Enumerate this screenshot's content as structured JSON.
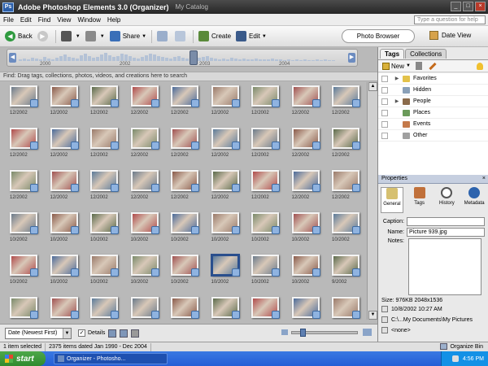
{
  "titlebar": {
    "logo": "Ps",
    "title": "Adobe Photoshop Elements 3.0 (Organizer)",
    "catalog": "My Catalog",
    "controls": [
      "_",
      "□",
      "×"
    ]
  },
  "menu": {
    "items": [
      "File",
      "Edit",
      "Find",
      "View",
      "Window",
      "Help"
    ],
    "help_placeholder": "Type a question for help"
  },
  "toolbar": {
    "back": "Back",
    "share": "Share",
    "create": "Create",
    "edit": "Edit",
    "photo_browser": "Photo Browser",
    "date_view": "Date View"
  },
  "timeline": {
    "years": [
      "2000",
      "2002",
      "2003",
      "2004"
    ]
  },
  "findbar": {
    "text": "Find: Drag tags, collections, photos, videos, and creations here to search"
  },
  "grid": {
    "rows": [
      [
        "12/2002",
        "12/2002",
        "12/2002",
        "12/2002",
        "12/2002",
        "12/2002",
        "12/2002",
        "12/2002",
        "12/2002"
      ],
      [
        "12/2002",
        "12/2002",
        "12/2002",
        "12/2002",
        "12/2002",
        "12/2002",
        "12/2002",
        "12/2002",
        "12/2002"
      ],
      [
        "12/2002",
        "12/2002",
        "12/2002",
        "12/2002",
        "12/2002",
        "12/2002",
        "12/2002",
        "12/2002",
        "12/2002"
      ],
      [
        "10/2002",
        "10/2002",
        "10/2002",
        "10/2002",
        "10/2002",
        "10/2002",
        "10/2002",
        "10/2002",
        "10/2002"
      ],
      [
        "10/2002",
        "10/2002",
        "10/2002",
        "10/2002",
        "10/2002",
        "10/2002",
        "10/2002",
        "10/2002",
        "9/2002"
      ],
      [
        "",
        "",
        "",
        "",
        "",
        "",
        "",
        "",
        ""
      ]
    ],
    "selected_row": 4,
    "selected_col": 5,
    "photo_colors": [
      "#6a7a8a",
      "#8a5a4a",
      "#5a6a4a",
      "#b04a4a",
      "#4a6a9a",
      "#9a7a6a",
      "#7a8a6a",
      "#a05050",
      "#5a7a9a"
    ]
  },
  "bottombar": {
    "sort": "Date (Newest First)",
    "details_label": "Details",
    "details_checked": "✓"
  },
  "panel": {
    "tabs": [
      "Tags",
      "Collections"
    ],
    "new_label": "New",
    "tags": [
      {
        "label": "Favorites",
        "arrow": "▶",
        "icon": "ti-fav"
      },
      {
        "label": "Hidden",
        "arrow": "",
        "icon": "ti-hidden"
      },
      {
        "label": "People",
        "arrow": "▶",
        "icon": "ti-people"
      },
      {
        "label": "Places",
        "arrow": "",
        "icon": "ti-places"
      },
      {
        "label": "Events",
        "arrow": "",
        "icon": "ti-events"
      },
      {
        "label": "Other",
        "arrow": "",
        "icon": "ti-other"
      }
    ]
  },
  "properties": {
    "header": "Properties",
    "tabs": [
      "General",
      "Tags",
      "History",
      "Metadata"
    ],
    "caption_label": "Caption:",
    "name_label": "Name:",
    "name_value": "Picture 939.jpg",
    "notes_label": "Notes:",
    "size": "Size: 976KB  2048x1536",
    "date": "10/8/2002 10:27 AM",
    "path": "C:\\...My Documents\\My Pictures",
    "audio": "<none>"
  },
  "status": {
    "selected": "1 item selected",
    "range": "2375 items dated Jan 1990 - Dec 2004",
    "organize_bin": "Organize Bin"
  },
  "taskbar": {
    "start": "start",
    "task": "Organizer - Photosho...",
    "time": "4:56 PM"
  }
}
